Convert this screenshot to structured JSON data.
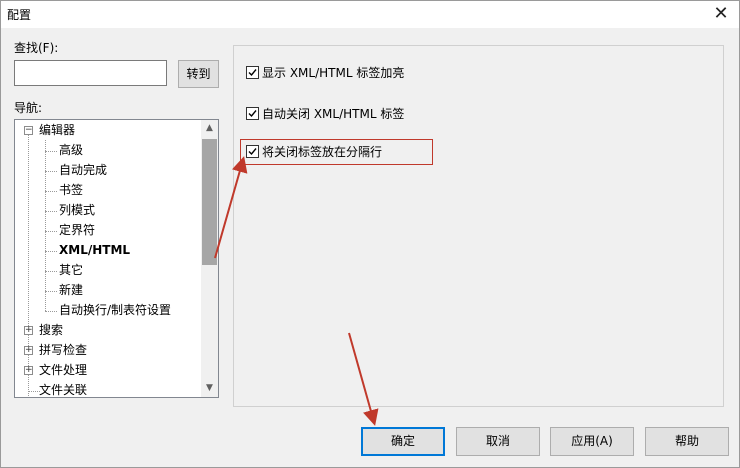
{
  "window": {
    "title": "配置"
  },
  "find": {
    "label": "查找(F):",
    "value": "",
    "goto_label": "转到"
  },
  "nav": {
    "label": "导航:",
    "items": [
      {
        "label": "编辑器",
        "expander": "⊟"
      },
      {
        "label": "高级"
      },
      {
        "label": "自动完成"
      },
      {
        "label": "书签"
      },
      {
        "label": "列模式"
      },
      {
        "label": "定界符"
      },
      {
        "label": "XML/HTML",
        "selected": true
      },
      {
        "label": "其它"
      },
      {
        "label": "新建"
      },
      {
        "label": "自动换行/制表符设置"
      },
      {
        "label": "搜索",
        "expander": "⊞"
      },
      {
        "label": "拼写检查",
        "expander": "⊞"
      },
      {
        "label": "文件处理",
        "expander": "⊞"
      },
      {
        "label": "文件关联"
      }
    ]
  },
  "options": [
    {
      "label": "显示 XML/HTML 标签加亮",
      "checked": true
    },
    {
      "label": "自动关闭 XML/HTML 标签",
      "checked": true
    },
    {
      "label": "将关闭标签放在分隔行",
      "checked": true
    }
  ],
  "buttons": {
    "ok": "确定",
    "cancel": "取消",
    "apply": "应用(A)",
    "help": "帮助"
  },
  "colors": {
    "highlight": "#c0392b",
    "focus_border": "#0078d7",
    "panel_bg": "#f0f0f0"
  }
}
